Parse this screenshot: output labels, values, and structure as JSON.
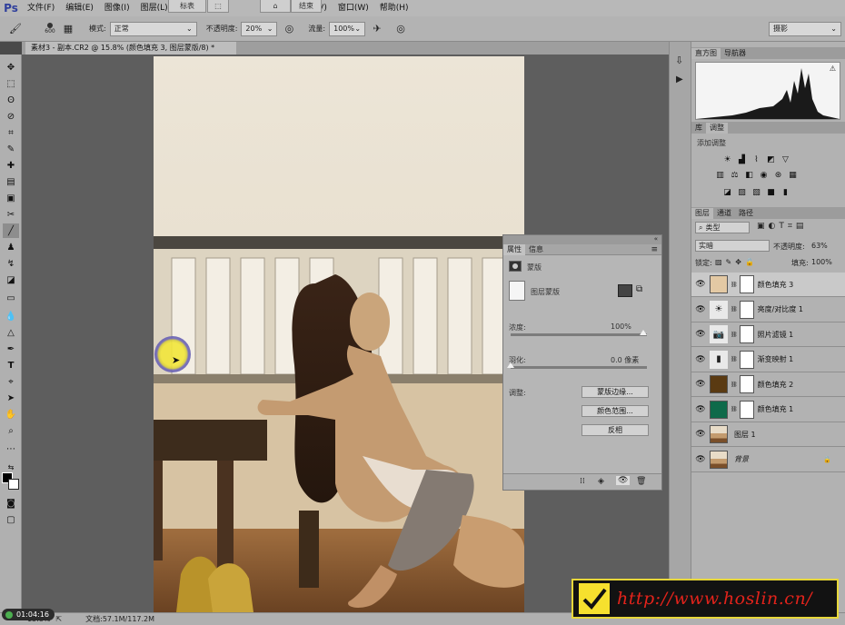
{
  "menu": {
    "logo": "Ps",
    "items": [
      "文件(F)",
      "编辑(E)",
      "图像(I)",
      "图层(L)"
    ],
    "items_right": [
      "(V)",
      "窗口(W)",
      "帮助(H)"
    ],
    "overlay_tabs": [
      "标表",
      "",
      "",
      "结束"
    ]
  },
  "options": {
    "brush_size": "600",
    "mode_label": "模式:",
    "mode_value": "正常",
    "opacity_label": "不透明度:",
    "opacity_value": "20%",
    "flow_label": "流量:",
    "flow_value": "100%",
    "workspace": "摄影"
  },
  "document": {
    "tab_title": "素材3 - 副本.CR2 @ 15.8% (颜色填充 3, 图层蒙版/8) *"
  },
  "properties": {
    "tabs": [
      "属性",
      "信息"
    ],
    "section_title": "蒙版",
    "mask_type": "图层蒙版",
    "density_label": "浓度:",
    "density_value": "100%",
    "density_level": 1.0,
    "feather_label": "羽化:",
    "feather_value": "0.0 像素",
    "feather_level": 0.0,
    "adjust_label": "调整:",
    "buttons": [
      "蒙版边缘...",
      "颜色范围...",
      "反相"
    ]
  },
  "histogram_panel": {
    "tabs": [
      "直方图",
      "导航器"
    ]
  },
  "adjustments_panel": {
    "tabs": [
      "库",
      "调整"
    ],
    "title": "添加调整"
  },
  "layers_panel": {
    "tabs": [
      "图层",
      "通道",
      "路径"
    ],
    "filter_label": "类型",
    "blend_mode": "实暗",
    "opacity_label": "不透明度:",
    "opacity_value": "63%",
    "lock_label": "锁定:",
    "fill_label": "填充:",
    "fill_value": "100%",
    "layers": [
      {
        "name": "颜色填充 3",
        "thumb": "#e3c9a4",
        "mask": true,
        "selected": true
      },
      {
        "name": "亮度/对比度 1",
        "thumb": "icon-sun",
        "mask": true,
        "selected": false
      },
      {
        "name": "照片滤镜 1",
        "thumb": "icon-camera",
        "mask": true,
        "selected": false
      },
      {
        "name": "渐变映射 1",
        "thumb": "icon-gradient",
        "mask": true,
        "selected": false
      },
      {
        "name": "颜色填充 2",
        "thumb": "#5a3a12",
        "mask": true,
        "selected": false
      },
      {
        "name": "颜色填充 1",
        "thumb": "#0e6a4a",
        "mask": true,
        "selected": false
      },
      {
        "name": "图层 1",
        "thumb": "photo",
        "mask": false,
        "selected": false
      },
      {
        "name": "背景",
        "thumb": "photo",
        "mask": false,
        "selected": false
      }
    ]
  },
  "status": {
    "zoom": "15.8%",
    "doc_label": "文档:57.1M/117.2M"
  },
  "timer": "01:04:16",
  "watermark": "http://www.hoslin.cn/",
  "colors": {
    "accent_logo": "#2f3f9c",
    "watermark_text": "#e3231b",
    "watermark_border": "#e7d73a"
  }
}
